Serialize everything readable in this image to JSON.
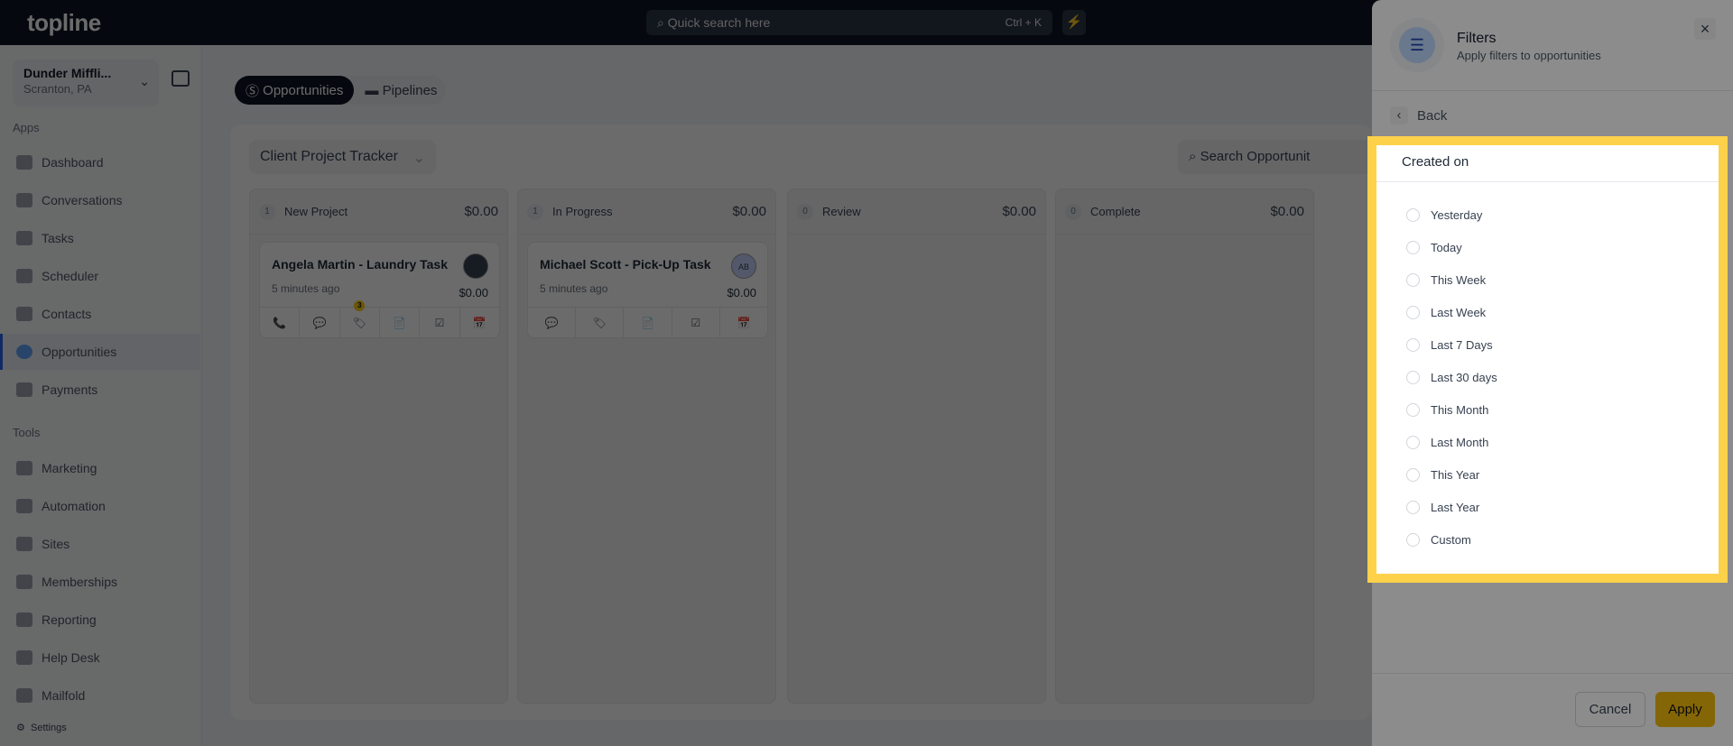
{
  "app": {
    "logo": "topline",
    "search_placeholder": "Quick search here",
    "search_shortcut": "Ctrl + K"
  },
  "location": {
    "name": "Dunder Miffli...",
    "city": "Scranton, PA"
  },
  "sidebar": {
    "apps_label": "Apps",
    "tools_label": "Tools",
    "apps": [
      {
        "label": "Dashboard"
      },
      {
        "label": "Conversations"
      },
      {
        "label": "Tasks"
      },
      {
        "label": "Scheduler"
      },
      {
        "label": "Contacts"
      },
      {
        "label": "Opportunities",
        "active": true
      },
      {
        "label": "Payments"
      }
    ],
    "tools": [
      {
        "label": "Marketing"
      },
      {
        "label": "Automation"
      },
      {
        "label": "Sites"
      },
      {
        "label": "Memberships"
      },
      {
        "label": "Reporting"
      },
      {
        "label": "Help Desk"
      },
      {
        "label": "Mailfold"
      }
    ],
    "settings": "Settings"
  },
  "tabs": [
    {
      "label": "Opportunities",
      "active": true
    },
    {
      "label": "Pipelines"
    }
  ],
  "pipeline": {
    "selected": "Client Project Tracker",
    "search_placeholder": "Search Opportunit"
  },
  "columns": [
    {
      "name": "New Project",
      "count": "1",
      "amount": "$0.00",
      "cards": [
        {
          "title": "Angela Martin - Laundry Task",
          "time": "5 minutes ago",
          "value": "$0.00",
          "tag_badge": "3"
        }
      ]
    },
    {
      "name": "In Progress",
      "count": "1",
      "amount": "$0.00",
      "cards": [
        {
          "title": "Michael Scott - Pick-Up Task",
          "time": "5 minutes ago",
          "value": "$0.00",
          "avatar": "AB"
        }
      ]
    },
    {
      "name": "Review",
      "count": "0",
      "amount": "$0.00"
    },
    {
      "name": "Complete",
      "count": "0",
      "amount": "$0.00"
    }
  ],
  "filters": {
    "title": "Filters",
    "subtitle": "Apply filters to opportunities",
    "back": "Back",
    "section": "Created on",
    "options": [
      "Yesterday",
      "Today",
      "This Week",
      "Last Week",
      "Last 7 Days",
      "Last 30 days",
      "This Month",
      "Last Month",
      "This Year",
      "Last Year",
      "Custom"
    ],
    "cancel": "Cancel",
    "apply": "Apply"
  },
  "colors": {
    "accent": "#f0b90b",
    "highlight": "#fdd14a",
    "topbar": "#0b1324"
  }
}
